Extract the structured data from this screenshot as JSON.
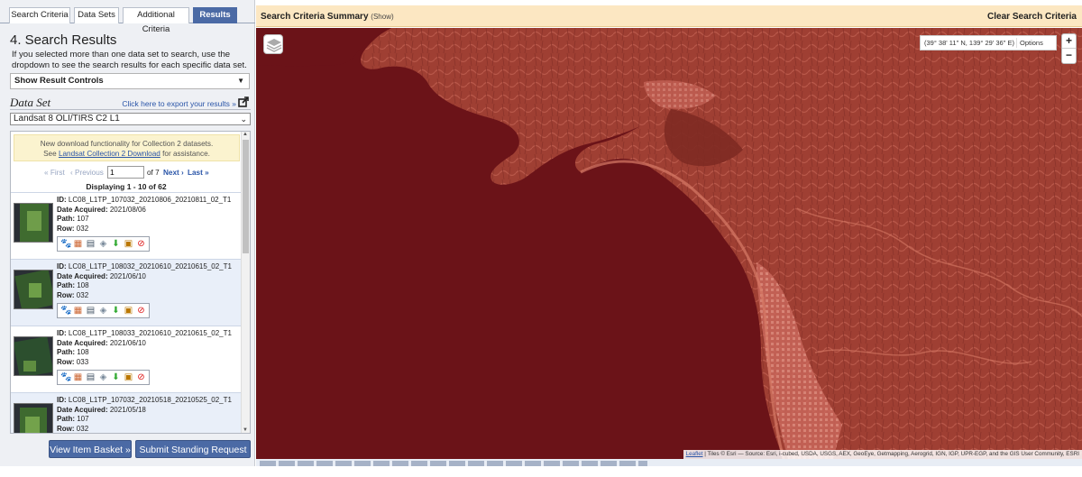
{
  "tabs": [
    "Search Criteria",
    "Data Sets",
    "Additional Criteria",
    "Results"
  ],
  "results": {
    "title": "4. Search Results",
    "help": "If you selected more than one data set to search, use the dropdown to see the search results for each specific data set.",
    "controls_label": "Show Result Controls",
    "dataset_label": "Data Set",
    "export_link": "Click here to export your results »",
    "dataset_selected": "Landsat 8 OLI/TIRS C2 L1",
    "notice_line1": "New download functionality for Collection 2 datasets.",
    "notice_see": "See",
    "notice_link": "Landsat Collection 2 Download",
    "notice_tail": "for assistance.",
    "pager": {
      "first": "« First",
      "previous": "‹ Previous",
      "page": "1",
      "of": "of 7",
      "next": "Next ›",
      "last": "Last »"
    },
    "displaying": "Displaying 1 - 10 of 62",
    "labels": {
      "id": "ID:",
      "date": "Date Acquired:",
      "path": "Path:",
      "row": "Row:"
    },
    "items": [
      {
        "id": "LC08_L1TP_107032_20210806_20210811_02_T1",
        "date": "2021/08/06",
        "path": "107",
        "row": "032"
      },
      {
        "id": "LC08_L1TP_108032_20210610_20210615_02_T1",
        "date": "2021/06/10",
        "path": "108",
        "row": "032"
      },
      {
        "id": "LC08_L1TP_108033_20210610_20210615_02_T1",
        "date": "2021/06/10",
        "path": "108",
        "row": "033"
      },
      {
        "id": "LC08_L1TP_107032_20210518_20210525_02_T1",
        "date": "2021/05/18",
        "path": "107",
        "row": "032"
      }
    ],
    "view_basket": "View Item Basket »",
    "standing_request": "Submit Standing Request »"
  },
  "map": {
    "summary_title": "Search Criteria Summary",
    "summary_show": "(Show)",
    "clear": "Clear Search Criteria",
    "coords": "(39° 38' 11\" N, 139° 29' 36\" E)",
    "options": "Options",
    "zoom_in": "+",
    "zoom_out": "−",
    "attribution_link": "Leaflet",
    "attribution_text": "| Tiles © Esri — Source: Esri, i-cubed, USDA, USGS, AEX, GeoEye, Getmapping, Aerogrid, IGN, IGP, UPR-EGP, and the GIS User Community, ESRI"
  },
  "icons": {
    "footprint": "footprint-icon",
    "browse": "browse-overlay-icon",
    "metadata": "metadata-icon",
    "compare": "compare-icon",
    "download": "download-icon",
    "bulk": "bulk-download-icon",
    "exclude": "exclude-icon"
  },
  "colors": {
    "tab_active": "#4b6aa5",
    "header_bg": "#fce7c2",
    "water": "#6b1318",
    "land": "#a8473b"
  }
}
